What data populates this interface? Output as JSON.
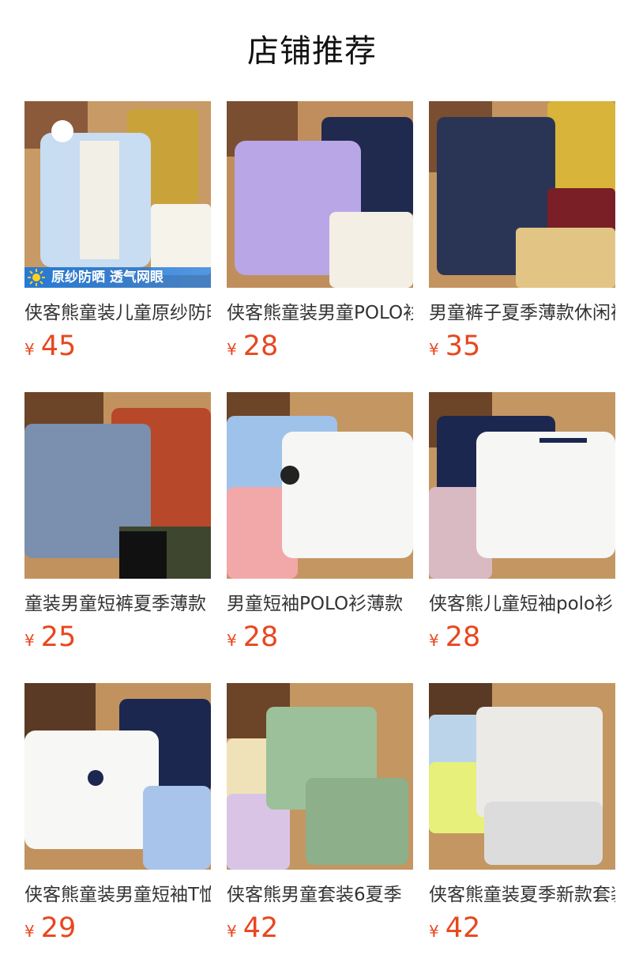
{
  "header": {
    "title": "店铺推荐"
  },
  "currency_symbol": "¥",
  "accent_color": "#e8471f",
  "products": [
    {
      "name": "侠客熊童装儿童原纱防晒衣",
      "price": "45",
      "badge": "原纱防晒 透气网眼"
    },
    {
      "name": "侠客熊童装男童POLO衫",
      "price": "28"
    },
    {
      "name": "男童裤子夏季薄款休闲裤",
      "price": "35"
    },
    {
      "name": "童装男童短裤夏季薄款",
      "price": "25"
    },
    {
      "name": "男童短袖POLO衫薄款",
      "price": "28"
    },
    {
      "name": "侠客熊儿童短袖polo衫",
      "price": "28"
    },
    {
      "name": "侠客熊童装男童短袖T恤",
      "price": "29"
    },
    {
      "name": "侠客熊男童套装6夏季",
      "price": "42"
    },
    {
      "name": "侠客熊童装夏季新款套装",
      "price": "42"
    }
  ]
}
